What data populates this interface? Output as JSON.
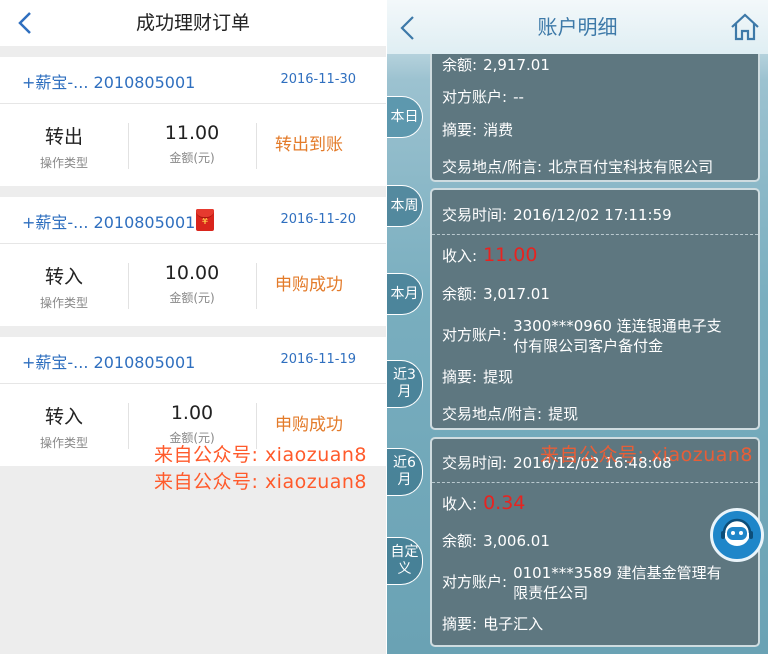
{
  "left": {
    "title": "成功理财订单",
    "orders": [
      {
        "product": "+薪宝-... 2010805001",
        "date": "2016-11-30",
        "op_value": "转出",
        "op_label": "操作类型",
        "amount": "11.00",
        "amount_label": "金额(元)",
        "status": "转出到账",
        "has_red_packet": false
      },
      {
        "product": "+薪宝-... 2010805001",
        "date": "2016-11-20",
        "op_value": "转入",
        "op_label": "操作类型",
        "amount": "10.00",
        "amount_label": "金额(元)",
        "status": "申购成功",
        "has_red_packet": true
      },
      {
        "product": "+薪宝-... 2010805001",
        "date": "2016-11-19",
        "op_value": "转入",
        "op_label": "操作类型",
        "amount": "1.00",
        "amount_label": "金额(元)",
        "status": "申购成功",
        "has_red_packet": false
      }
    ],
    "red_packet_glyph": "¥"
  },
  "watermark": {
    "text": "来自公众号: xiaozuan8",
    "color": "#ff5a2b"
  },
  "right": {
    "title": "账户明细",
    "tabs": [
      "本日",
      "本周",
      "本月",
      "近3月",
      "近6月",
      "自定义"
    ],
    "card1": {
      "balance_label": "余额:",
      "balance": "2,917.01",
      "counterparty_label": "对方账户:",
      "counterparty": "--",
      "summary_label": "摘要:",
      "summary": "消费",
      "place_label": "交易地点/附言:",
      "place": "北京百付宝科技有限公司"
    },
    "card2": {
      "time_label": "交易时间:",
      "time": "2016/12/02  17:11:59",
      "income_label": "收入:",
      "income": "11.00",
      "balance_label": "余额:",
      "balance": "3,017.01",
      "counterparty_label": "对方账户:",
      "counterparty": "3300***0960  连连银通电子支付有限公司客户备付金",
      "summary_label": "摘要:",
      "summary": "提现",
      "place_label": "交易地点/附言:",
      "place": "提现"
    },
    "card3": {
      "time_label": "交易时间:",
      "time": "2016/12/02  16:48:08",
      "income_label": "收入:",
      "income": "0.34",
      "balance_label": "余额:",
      "balance": "3,006.01",
      "counterparty_label": "对方账户:",
      "counterparty": "0101***3589  建信基金管理有限责任公司",
      "summary_label": "摘要:",
      "summary": "电子汇入"
    },
    "icons": {
      "back": "back-chevron-icon",
      "home": "home-icon",
      "service": "customer-service-icon"
    }
  },
  "colors": {
    "link_blue": "#2f6fbf",
    "status_orange": "#e37b2a",
    "income_red": "#e82320",
    "title_blue": "#3d79a8"
  }
}
